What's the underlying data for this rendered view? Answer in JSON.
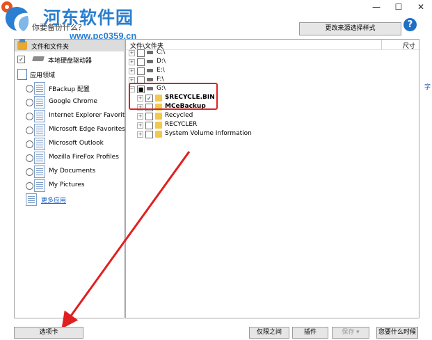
{
  "window": {
    "controls": [
      "—",
      "☐",
      "✕"
    ]
  },
  "watermark": {
    "title": "河东软件园",
    "url": "www.pc0359.cn"
  },
  "header": {
    "question": "你要备份什么？",
    "change_style_label": "更改来源选择样式",
    "help": "?"
  },
  "left_panel": {
    "files_label": "文件和文件夹",
    "local_drive_label": "本地硬盘驱动器",
    "local_drive_checked": "✓",
    "apps_label": "应用领域",
    "apps": [
      "FBackup 配置",
      "Google Chrome",
      "Internet Explorer Favorite",
      "Microsoft Edge Favorites",
      "Microsoft Outlook",
      "Mozilla FireFox Profiles",
      "My Documents",
      "My Pictures"
    ],
    "more_apps_label": "更多应用"
  },
  "right_panel": {
    "col_path": "文件\\文件夹",
    "col_size": "尺寸",
    "drives": [
      {
        "label": "C:\\",
        "expander": "+",
        "check": ""
      },
      {
        "label": "D:\\",
        "expander": "+",
        "check": ""
      },
      {
        "label": "E:\\",
        "expander": "+",
        "check": ""
      },
      {
        "label": "F:\\",
        "expander": "+",
        "check": ""
      },
      {
        "label": "G:\\",
        "expander": "−",
        "check": "■"
      }
    ],
    "g_children": [
      {
        "label": "$RECYCLE.BIN",
        "bold": true,
        "check": "✓"
      },
      {
        "label": "MCeBackup",
        "bold": true,
        "check": ""
      },
      {
        "label": "Recycled",
        "bold": false,
        "check": ""
      },
      {
        "label": "RECYCLER",
        "bold": false,
        "check": ""
      },
      {
        "label": "System Volume Information",
        "bold": false,
        "check": ""
      }
    ]
  },
  "bottom": {
    "options_label": "选项卡",
    "only_label": "仅限之间",
    "plugins_label": "插件",
    "save_label": "保存",
    "save_arrow": "▾",
    "when_label": "您要什么时候"
  },
  "colors": {
    "accent_blue": "#2a7fd0",
    "annotation_red": "#e02020"
  },
  "side_fragment": "字"
}
